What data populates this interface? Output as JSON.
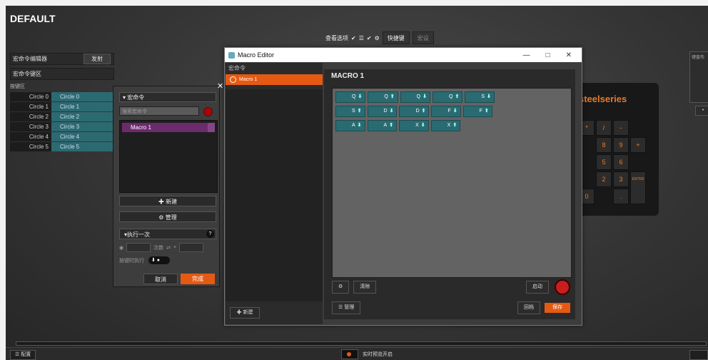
{
  "profile_title": "DEFAULT",
  "topbar": {
    "view_option": "查看选项",
    "shortcut": "快捷键",
    "other": "宏设"
  },
  "left": {
    "macro_editor_label": "宏命令编辑器",
    "macro_editor_btn": "发射",
    "macro_key_area": "宏命令键区",
    "key_area": "按键区",
    "rows": [
      {
        "k": "Circle 0",
        "v": "Circle 0"
      },
      {
        "k": "Circle 1",
        "v": "Circle 1"
      },
      {
        "k": "Circle 2",
        "v": "Circle 2"
      },
      {
        "k": "Circle 3",
        "v": "Circle 3"
      },
      {
        "k": "Circle 4",
        "v": "Circle 4"
      },
      {
        "k": "Circle 5",
        "v": "Circle 5"
      }
    ]
  },
  "macro_panel": {
    "header": "宏命令",
    "search_placeholder": "搜索宏命令",
    "item": "Macro 1",
    "new_btn": "新建",
    "manage_btn": "管理",
    "run_mode": "执行一次",
    "help": "?",
    "times_label": "次数",
    "repeat_label": "× ",
    "hold_label": "按键时执行",
    "cancel": "取消",
    "done": "完成"
  },
  "keyboard": {
    "brand": "steelseries",
    "keys": [
      "*",
      "/",
      "-",
      "8",
      "9",
      "+",
      "5",
      "6",
      "2",
      "3",
      "0",
      ".",
      "ENTER"
    ]
  },
  "right_panel": {
    "label": "键盘布"
  },
  "bottom": {
    "config": "配置",
    "live_preview": "实时预览开启"
  },
  "editor": {
    "window_title": "Macro Editor",
    "list_header": "宏命令",
    "list_item": "Macro 1",
    "new_btn": "新建",
    "macro_title": "MACRO 1",
    "events": [
      [
        {
          "k": "Q",
          "d": "down"
        },
        {
          "k": "Q",
          "d": "up"
        },
        {
          "k": "Q",
          "d": "down"
        },
        {
          "k": "Q",
          "d": "up"
        },
        {
          "k": "S",
          "d": "down"
        }
      ],
      [
        {
          "k": "S",
          "d": "up"
        },
        {
          "k": "D",
          "d": "down"
        },
        {
          "k": "D",
          "d": "up"
        },
        {
          "k": "F",
          "d": "down"
        },
        {
          "k": "F",
          "d": "up"
        }
      ],
      [
        {
          "k": "A",
          "d": "down"
        },
        {
          "k": "A",
          "d": "up"
        },
        {
          "k": "X",
          "d": "down"
        },
        {
          "k": "X",
          "d": "up"
        }
      ]
    ],
    "clear_btn": "清除",
    "start_btn": "启动",
    "manage_btn": "管理",
    "cancel_btn": "回档",
    "save_btn": "保存",
    "colors": {
      "accent": "#e55a13",
      "event": "#2a6b72",
      "record": "#c81e1e"
    }
  }
}
